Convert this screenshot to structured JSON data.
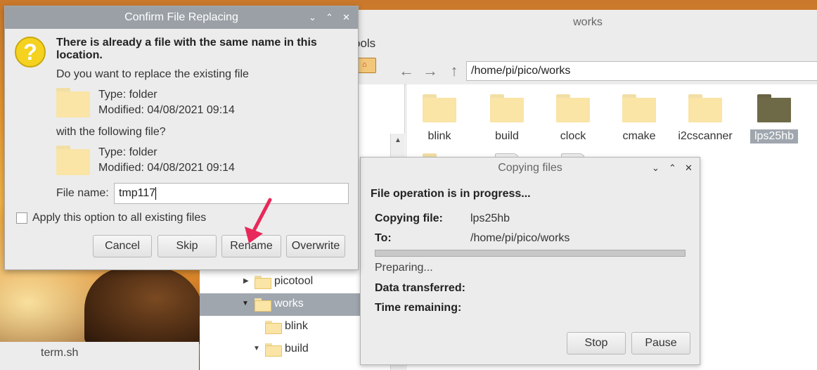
{
  "desktop": {
    "file_label": "term.sh"
  },
  "file_manager": {
    "window_title": "works",
    "menu_partial": "ools",
    "address": "/home/pi/pico/works",
    "items": [
      {
        "name": "blink",
        "selected": false
      },
      {
        "name": "build",
        "selected": false
      },
      {
        "name": "clock",
        "selected": false
      },
      {
        "name": "cmake",
        "selected": false
      },
      {
        "name": "i2cscanner",
        "selected": false
      },
      {
        "name": "lps25hb",
        "selected": true
      }
    ],
    "tree": [
      {
        "label": "picotool",
        "expander": "▶",
        "selected": false
      },
      {
        "label": "works",
        "expander": "▼",
        "selected": true
      },
      {
        "label": "blink",
        "expander": "",
        "selected": false
      },
      {
        "label": "build",
        "expander": "▼",
        "selected": false
      }
    ]
  },
  "copy_dialog": {
    "title": "Copying files",
    "status": "File operation is in progress...",
    "copying_file_label": "Copying file:",
    "copying_file_value": "lps25hb",
    "to_label": "To:",
    "to_value": "/home/pi/pico/works",
    "progress": 0,
    "preparing": "Preparing...",
    "data_transferred_label": "Data transferred:",
    "time_remaining_label": "Time remaining:",
    "stop_label": "Stop",
    "pause_label": "Pause"
  },
  "confirm_dialog": {
    "title": "Confirm File Replacing",
    "headline": "There is already a file with the same name in this location.",
    "question_replace": "Do you want to replace the existing file",
    "existing_type": "Type: folder",
    "existing_modified": "Modified: 04/08/2021 09:14",
    "question_with": "with the following file?",
    "new_type": "Type: folder",
    "new_modified": "Modified: 04/08/2021 09:14",
    "file_name_label": "File name:",
    "file_name_value": "tmp117",
    "apply_all_label": "Apply this option to all existing files",
    "apply_all_checked": false,
    "cancel_label": "Cancel",
    "skip_label": "Skip",
    "rename_label": "Rename",
    "overwrite_label": "Overwrite"
  },
  "icons": {
    "question": "?",
    "minimize": "⌄",
    "maximize": "⌃",
    "close": "✕",
    "back": "←",
    "forward": "→",
    "up": "↑"
  },
  "colors": {
    "title_active": "#9aa0a6",
    "selection": "#9fa6ae",
    "folder": "#fae4a6",
    "annotation_arrow": "#e8285a"
  }
}
